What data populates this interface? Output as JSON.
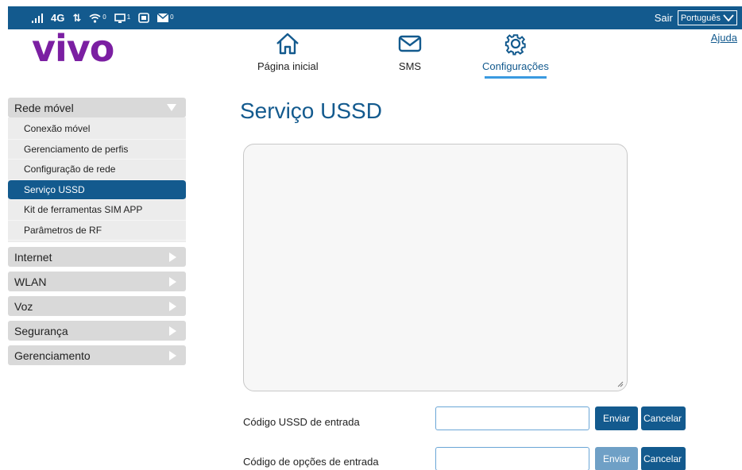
{
  "status": {
    "signal_label": ".ıll",
    "network": "4G",
    "data_arrows": "⇅",
    "wifi_count": "0",
    "devices_count": "1",
    "messages_count": "0",
    "logout": "Sair",
    "language": "Português"
  },
  "header": {
    "logo": "vivo",
    "nav": [
      {
        "label": "Página inicial",
        "icon": "home-icon"
      },
      {
        "label": "SMS",
        "icon": "envelope-icon"
      },
      {
        "label": "Configurações",
        "icon": "gear-icon",
        "active": true
      }
    ],
    "help": "Ajuda"
  },
  "sidebar": {
    "groups": [
      {
        "label": "Rede móvel",
        "expanded": true
      },
      {
        "label": "Internet"
      },
      {
        "label": "WLAN"
      },
      {
        "label": "Voz"
      },
      {
        "label": "Segurança"
      },
      {
        "label": "Gerenciamento"
      }
    ],
    "rede_movel_items": [
      {
        "label": "Conexão móvel"
      },
      {
        "label": "Gerenciamento de perfis"
      },
      {
        "label": "Configuração de rede"
      },
      {
        "label": "Serviço USSD",
        "active": true
      },
      {
        "label": "Kit de ferramentas SIM APP"
      },
      {
        "label": "Parâmetros de RF"
      }
    ]
  },
  "main": {
    "title": "Serviço USSD",
    "output_value": "",
    "form": {
      "ussd_label": "Código USSD de entrada",
      "ussd_value": "",
      "options_label": "Código de opções de entrada",
      "options_value": "",
      "send_label": "Enviar",
      "cancel_label": "Cancelar"
    }
  },
  "colors": {
    "brand_blue": "#135a8e",
    "brand_purple": "#7b1fa2",
    "accent_light_blue": "#3a9ae0"
  }
}
